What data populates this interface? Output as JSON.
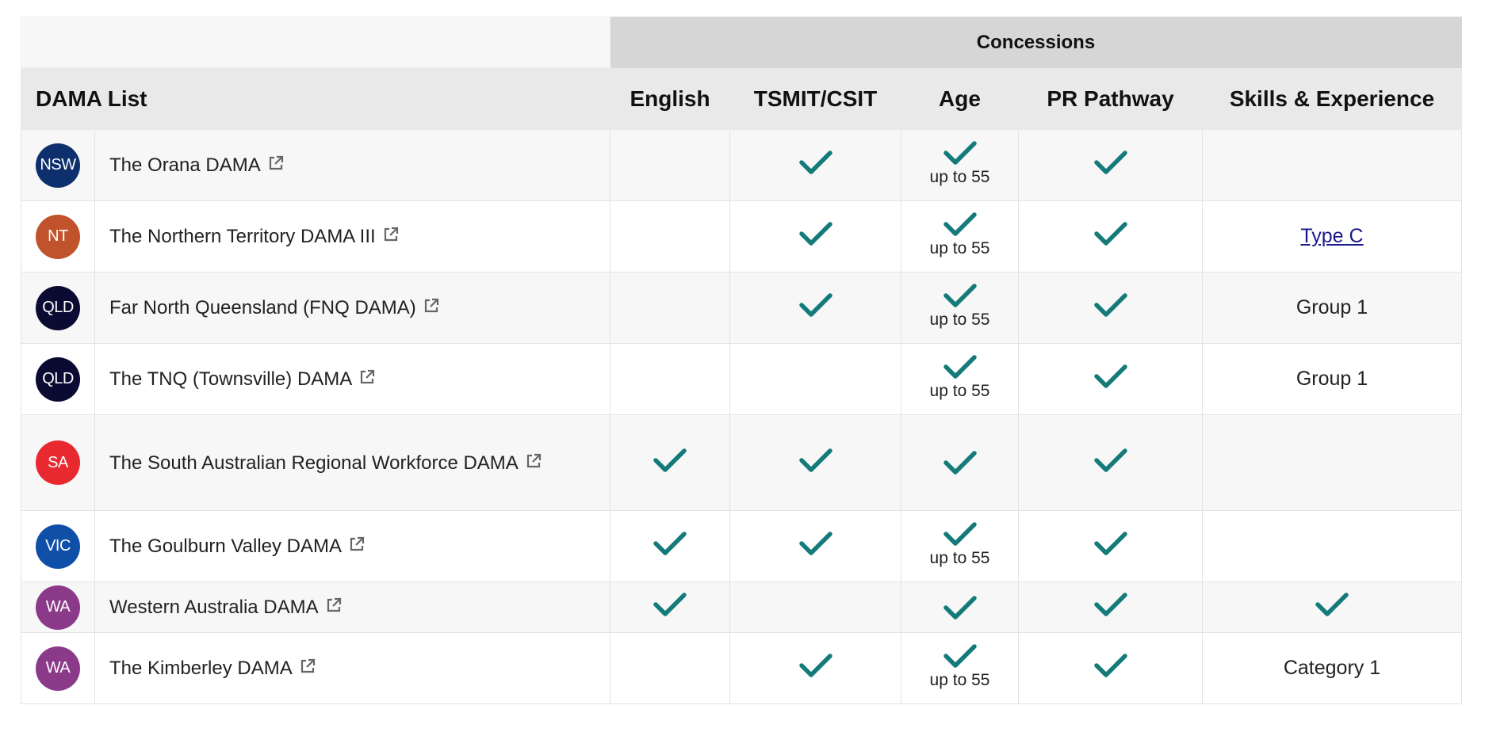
{
  "table": {
    "group_header": {
      "concessions": "Concessions"
    },
    "columns": {
      "list": "DAMA List",
      "english": "English",
      "tsmit": "TSMIT/CSIT",
      "age": "Age",
      "pr": "PR Pathway",
      "skills": "Skills & Experience"
    },
    "rows": [
      {
        "badge": "NSW",
        "badge_color": "#0d2f6b",
        "name": "The Orana DAMA",
        "english": false,
        "tsmit": true,
        "age": true,
        "age_note": "up to 55",
        "pr": true,
        "skills": null,
        "skills_link": false
      },
      {
        "badge": "NT",
        "badge_color": "#c0532b",
        "name": "The Northern Territory DAMA III",
        "english": false,
        "tsmit": true,
        "age": true,
        "age_note": "up to 55",
        "pr": true,
        "skills": "Type C",
        "skills_link": true
      },
      {
        "badge": "QLD",
        "badge_color": "#0a0a33",
        "name": "Far North Queensland (FNQ DAMA)",
        "english": false,
        "tsmit": true,
        "age": true,
        "age_note": "up to 55",
        "pr": true,
        "skills": "Group 1",
        "skills_link": false
      },
      {
        "badge": "QLD",
        "badge_color": "#0a0a33",
        "name": "The TNQ (Townsville) DAMA",
        "english": false,
        "tsmit": false,
        "age": true,
        "age_note": "up to 55",
        "pr": true,
        "skills": "Group 1",
        "skills_link": false
      },
      {
        "badge": "SA",
        "badge_color": "#e8292f",
        "name": "The South Australian Regional Workforce DAMA",
        "english": true,
        "tsmit": true,
        "age": true,
        "age_note": null,
        "pr": true,
        "skills": null,
        "skills_link": false
      },
      {
        "badge": "VIC",
        "badge_color": "#0f4fa8",
        "name": "The Goulburn Valley DAMA",
        "english": true,
        "tsmit": true,
        "age": true,
        "age_note": "up to 55",
        "pr": true,
        "skills": null,
        "skills_link": false
      },
      {
        "badge": "WA",
        "badge_color": "#8b3a8a",
        "name": "Western Australia DAMA",
        "english": true,
        "tsmit": false,
        "age": true,
        "age_note": null,
        "pr": true,
        "skills": "check",
        "skills_link": false
      },
      {
        "badge": "WA",
        "badge_color": "#8b3a8a",
        "name": "The Kimberley DAMA",
        "english": false,
        "tsmit": true,
        "age": true,
        "age_note": "up to 55",
        "pr": true,
        "skills": "Category 1",
        "skills_link": false
      }
    ],
    "colors": {
      "check": "#157a7a",
      "link": "#1a1a8c"
    },
    "icons": {
      "check": "checkmark-icon",
      "external": "external-link-icon"
    }
  }
}
